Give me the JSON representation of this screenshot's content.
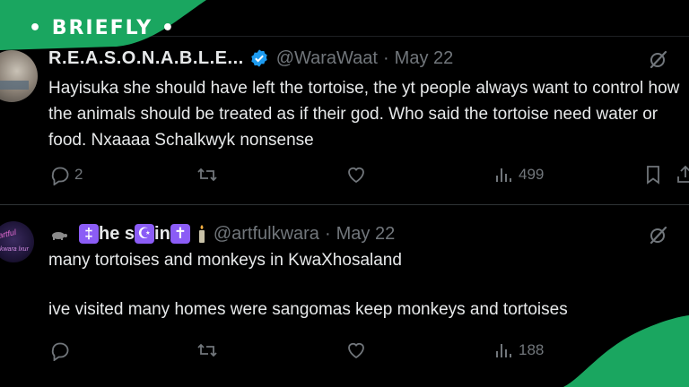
{
  "brand": {
    "logo_text": "• BRIEFLY •",
    "color": "#1aa660"
  },
  "tweets": [
    {
      "display_name": "R.E.A.S.O.N.A.B.L.E...",
      "verified": true,
      "handle": "@WaraWaat",
      "separator": "·",
      "date": "May 22",
      "text": "Hayisuka she should have left the tortoise, the yt people always want to control how the animals should be treated as if their god. Who said the tortoise need water or food. Nxaaaa Schalkwyk nonsense",
      "replies": "2",
      "retweets": "",
      "likes": "",
      "views": "499"
    },
    {
      "display_name_parts": [
        "‡",
        "he s",
        "☪",
        "in",
        "✝"
      ],
      "handle": "@artfulkwara",
      "separator": "·",
      "date": "May 22",
      "avatar_text": [
        "artful",
        "kwara lxur"
      ],
      "line1": "many tortoises and monkeys in KwaXhosaland",
      "line2": "ive visited many homes were sangomas keep monkeys and tortoises",
      "replies": "",
      "retweets": "",
      "likes": "",
      "views": "188"
    }
  ]
}
